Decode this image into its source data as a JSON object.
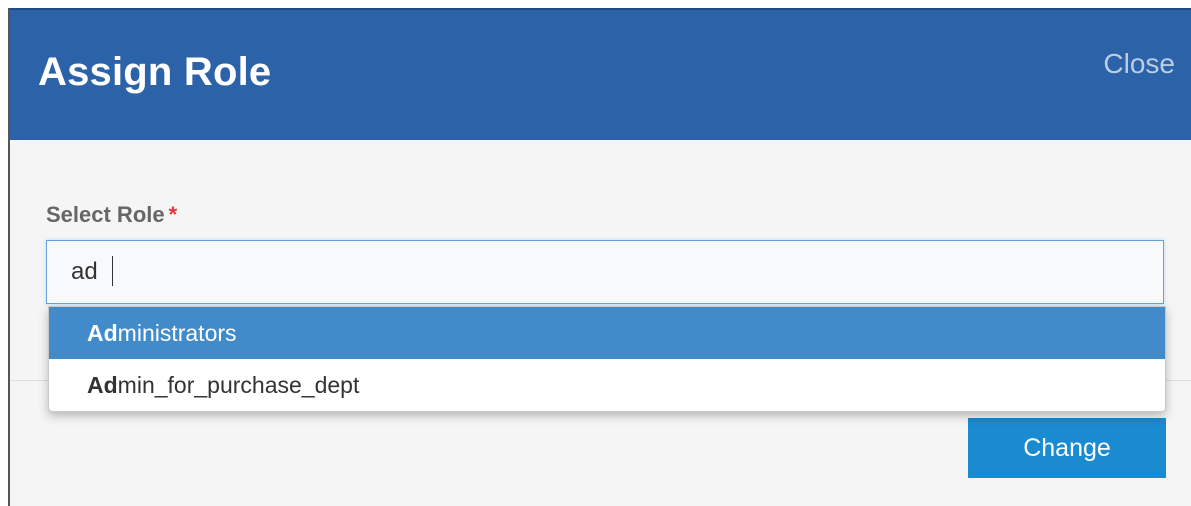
{
  "dialog": {
    "title": "Assign Role",
    "close_label": "Close"
  },
  "form": {
    "label": "Select Role",
    "required_mark": "*",
    "input_value": "ad",
    "options": [
      {
        "match": "Ad",
        "rest": "ministrators",
        "highlighted": true
      },
      {
        "match": "Ad",
        "rest": "min_for_purchase_dept",
        "highlighted": false
      }
    ]
  },
  "actions": {
    "change_label": "Change"
  },
  "colors": {
    "header_bg": "#2c62a8",
    "highlight_bg": "#428bca",
    "button_bg": "#1a8bd1",
    "required": "#e03a3a"
  }
}
